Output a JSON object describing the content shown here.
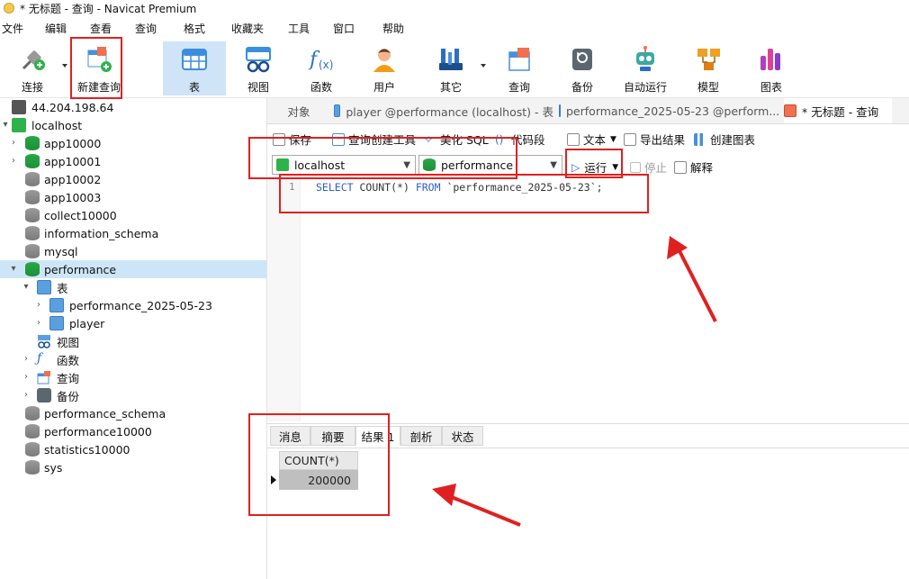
{
  "window": {
    "title": "* 无标题 - 查询 - Navicat Premium"
  },
  "menu": [
    "文件",
    "编辑",
    "查看",
    "查询",
    "格式",
    "收藏夹",
    "工具",
    "窗口",
    "帮助"
  ],
  "toolbar": {
    "connect": "连接",
    "new_query": "新建查询",
    "table": "表",
    "view": "视图",
    "function": "函数",
    "user": "用户",
    "other": "其它",
    "query": "查询",
    "backup": "备份",
    "auto_run": "自动运行",
    "model": "模型",
    "chart": "图表"
  },
  "tree": {
    "remote": "44.204.198.64",
    "localhost": "localhost",
    "dbs_top": [
      "app10000",
      "app10001",
      "app10002",
      "app10003",
      "collect10000",
      "information_schema",
      "mysql"
    ],
    "performance": "performance",
    "tables": "表",
    "table_items": [
      "performance_2025-05-23",
      "player"
    ],
    "views": "视图",
    "functions": "函数",
    "queries": "查询",
    "backups": "备份",
    "dbs_bottom": [
      "performance_schema",
      "performance10000",
      "statistics10000",
      "sys"
    ]
  },
  "tabs": {
    "objects": "对象",
    "t1": "player @performance (localhost) - 表",
    "t2": "performance_2025-05-23 @perform...",
    "t3": "* 无标题 - 查询"
  },
  "qbar": {
    "save": "保存",
    "builder": "查询创建工具",
    "beautify": "美化 SQL",
    "snippet": "代码段",
    "text": "文本",
    "export": "导出结果",
    "create_chart": "创建图表"
  },
  "conn": {
    "connection": "localhost",
    "database": "performance",
    "run": "运行",
    "stop": "停止",
    "explain": "解释"
  },
  "editor": {
    "line_no": "1",
    "kw_select": "SELECT",
    "fn_count": "COUNT(*)",
    "kw_from": "FROM",
    "table_ref": "`performance_2025-05-23`;"
  },
  "results": {
    "tabs": [
      "消息",
      "摘要",
      "结果 1",
      "剖析",
      "状态"
    ],
    "column": "COUNT(*)",
    "value": "200000"
  },
  "colors": {
    "accent": "#cfe4f7",
    "annotation": "#e02020"
  }
}
